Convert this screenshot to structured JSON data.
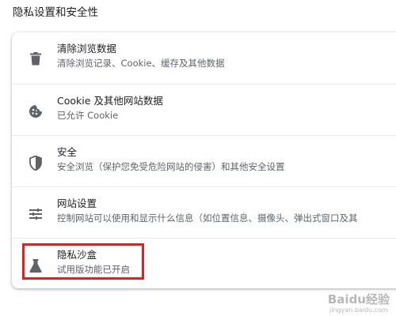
{
  "section": {
    "title": "隐私设置和安全性"
  },
  "items": [
    {
      "icon": "trash-icon",
      "label": "清除浏览数据",
      "sub": "清除浏览记录、Cookie、缓存及其他数据"
    },
    {
      "icon": "cookie-icon",
      "label": "Cookie 及其他网站数据",
      "sub": "已允许 Cookie"
    },
    {
      "icon": "shield-icon",
      "label": "安全",
      "sub": "安全浏览（保护您免受危险网站的侵害）和其他安全设置"
    },
    {
      "icon": "sliders-icon",
      "label": "网站设置",
      "sub": "控制网站可以使用和显示什么信息（如位置信息、摄像头、弹出式窗口及其"
    },
    {
      "icon": "flask-icon",
      "label": "隐私沙盒",
      "sub": "试用版功能已开启"
    }
  ],
  "watermark": {
    "main": "Baidu经验",
    "sub": "jingyan.baidu.com"
  },
  "colors": {
    "text_primary": "#202124",
    "text_secondary": "#5f6368",
    "icon": "#5f6368",
    "highlight": "#e02020"
  }
}
